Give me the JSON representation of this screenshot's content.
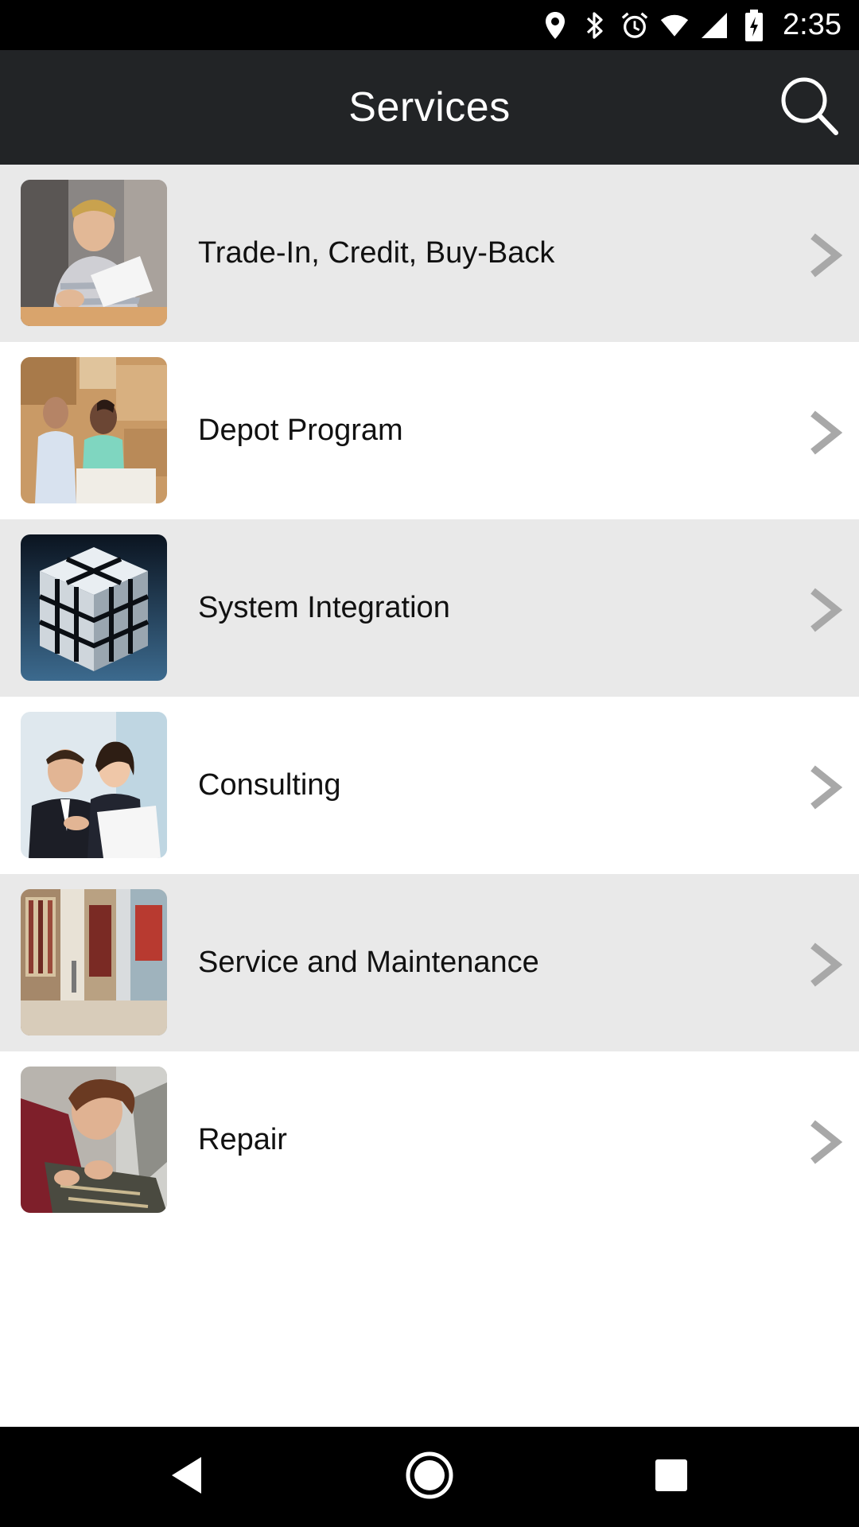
{
  "status_bar": {
    "time": "2:35",
    "icons": [
      "location-icon",
      "bluetooth-icon",
      "alarm-icon",
      "wifi-icon",
      "signal-icon",
      "battery-icon"
    ]
  },
  "app_bar": {
    "title": "Services",
    "search_icon": "search-icon"
  },
  "services": [
    {
      "label": "Trade-In, Credit, Buy-Back",
      "thumb": "trade-in-photo"
    },
    {
      "label": "Depot Program",
      "thumb": "depot-photo"
    },
    {
      "label": "System Integration",
      "thumb": "cube-photo"
    },
    {
      "label": "Consulting",
      "thumb": "consulting-photo"
    },
    {
      "label": "Service and Maintenance",
      "thumb": "store-photo"
    },
    {
      "label": "Repair",
      "thumb": "repair-photo"
    }
  ],
  "nav_bar": {
    "back_icon": "back-icon",
    "home_icon": "home-icon",
    "recents_icon": "recents-icon"
  },
  "colors": {
    "app_bar": "#222426",
    "row_shaded": "#e9e9e9",
    "row_plain": "#ffffff",
    "chevron": "#a8a8a8"
  }
}
